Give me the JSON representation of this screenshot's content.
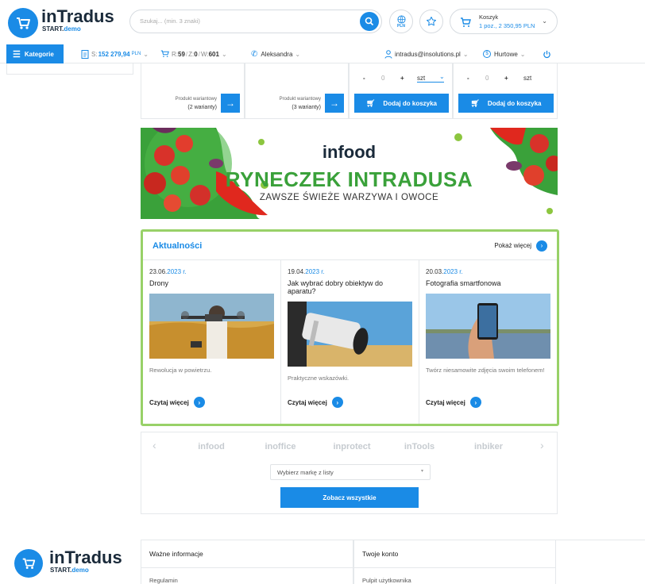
{
  "header": {
    "logo_title": "inTradus",
    "logo_sub_start": "START.",
    "logo_sub_demo": "demo",
    "search_placeholder": "Szukaj... (min. 3 znaki)",
    "currency": "PLN",
    "cart_title": "Koszyk",
    "cart_detail": "1 poz., 2 350,95 PLN"
  },
  "nav": {
    "categories": "Kategorie",
    "balance_prefix": "S:",
    "balance_value": "152 279,94",
    "balance_unit": "PLN",
    "orders_r": "R:",
    "orders_r_val": "59",
    "orders_z": "Z:",
    "orders_z_val": "0",
    "orders_w": "W:",
    "orders_w_val": "601",
    "contact": "Aleksandra",
    "email": "intradus@insolutions.pl",
    "price_mode": "Hurtowe"
  },
  "products": {
    "variant_label": "Produkt wariantowy",
    "variant_a": "(2 warianty)",
    "variant_b": "(3 warianty)",
    "qty_minus": "-",
    "qty_value": "0",
    "qty_plus": "+",
    "unit_a": "szt",
    "unit_b": "szt",
    "add_to_cart": "Dodaj do koszyka"
  },
  "banner": {
    "brand": "infood",
    "headline": "RYNECZEK INTRADUSA",
    "subline": "ZAWSZE ŚWIEŻE WARZYWA I OWOCE"
  },
  "news": {
    "title": "Aktualności",
    "show_more": "Pokaż więcej",
    "read_more": "Czytaj więcej",
    "items": [
      {
        "date_day": "23.06.",
        "date_year": "2023 r.",
        "title": "Drony",
        "desc": "Rewolucja w powietrzu."
      },
      {
        "date_day": "19.04.",
        "date_year": "2023 r.",
        "title": "Jak wybrać dobry obiektyw do aparatu?",
        "desc": "Praktyczne wskazówki."
      },
      {
        "date_day": "20.03.",
        "date_year": "2023 r.",
        "title": "Fotografia smartfonowa",
        "desc": "Twórz niesamowite zdjęcia swoim telefonem!"
      }
    ]
  },
  "brands": {
    "items": [
      "infood",
      "inoffice",
      "inprotect",
      "inTools",
      "inbiker"
    ],
    "select_placeholder": "Wybierz markę z listy",
    "see_all": "Zobacz wszystkie"
  },
  "footer": {
    "logo_title": "inTradus",
    "logo_sub_start": "START.",
    "logo_sub_demo": "demo",
    "col1_title": "Ważne informacje",
    "col1_item": "Regulamin",
    "col2_title": "Twoje konto",
    "col2_item": "Pulpit użytkownika"
  },
  "colors": {
    "accent": "#1a8be6",
    "news_border": "#98d168",
    "banner_green": "#3aa13a"
  }
}
